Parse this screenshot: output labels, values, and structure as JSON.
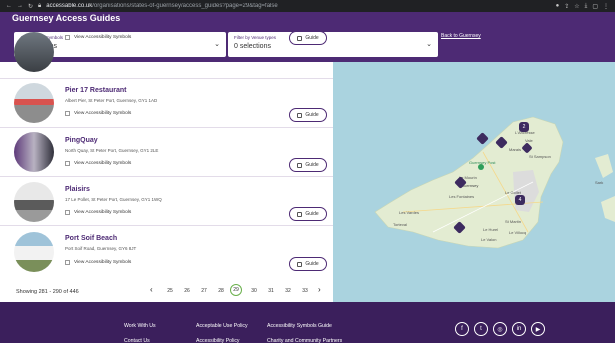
{
  "browser": {
    "url_host": "accessable.co.uk",
    "url_path": "/organisations/states-of-guernsey/access_guides?page=29&tag=false"
  },
  "header": {
    "title": "Guernsey Access Guides",
    "filter1_label": "Accessibility Symbols",
    "filter1_value": "0 selections",
    "filter2_label": "Filter by Venue types",
    "filter2_value": "0 selections",
    "back_link": "Back to Guernsey"
  },
  "list": {
    "view_symbols_label": "View Accessibility Symbols",
    "guide_label": "Guide",
    "items": [
      {
        "name": "",
        "address": ""
      },
      {
        "name": "Pier 17 Restaurant",
        "address": "Albert Pier, St Peter Port, Guernsey, GY1 1AD"
      },
      {
        "name": "PingQuay",
        "address": "North Quay, St Peter Port, Guernsey, GY1 2LE"
      },
      {
        "name": "Plaisirs",
        "address": "17 Le Pollet, St Peter Port, Guernsey, GY1 1WQ"
      },
      {
        "name": "Port Soif Beach",
        "address": "Port Soif Road, Guernsey, GY6 8JT"
      }
    ]
  },
  "pagination": {
    "showing": "Showing 281 - 290 of 446",
    "pages": [
      "25",
      "26",
      "27",
      "28",
      "29",
      "30",
      "31",
      "32",
      "33"
    ],
    "current": "29"
  },
  "map": {
    "labels": [
      "L'Ancresse",
      "Vale",
      "Marais",
      "St Sampson",
      "Le Mourin",
      "Guernsey",
      "Les Vardes",
      "Torteval",
      "Le Villocq",
      "St Martin",
      "Le Valon",
      "Le Hurel",
      "Les Fontaines",
      "Le Gollet",
      "Guernsey Post",
      "Sark"
    ],
    "cluster_counts": [
      "2",
      "4"
    ],
    "colors": {
      "sea": "#aad3df",
      "land": "#e6efd8",
      "marker": "#3d2b5f"
    }
  },
  "footer": {
    "col1": [
      "Work With Us",
      "Contact Us"
    ],
    "col2": [
      "Acceptable Use Policy",
      "Accessibility Policy"
    ],
    "col3": [
      "Accessibility Symbols Guide",
      "Charity and Community Partners"
    ],
    "social": [
      "facebook-icon",
      "twitter-icon",
      "instagram-icon",
      "linkedin-icon",
      "youtube-icon"
    ]
  }
}
